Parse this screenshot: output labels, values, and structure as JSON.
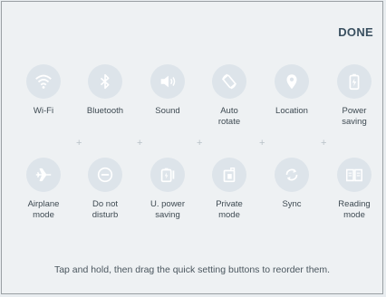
{
  "header": {
    "done_label": "DONE"
  },
  "tiles": {
    "wifi": "Wi-Fi",
    "bluetooth": "Bluetooth",
    "sound": "Sound",
    "auto_rotate": "Auto\nrotate",
    "location": "Location",
    "power_saving": "Power\nsaving",
    "airplane_mode": "Airplane\nmode",
    "do_not_disturb": "Do not\ndisturb",
    "u_power_saving": "U. power\nsaving",
    "private_mode": "Private\nmode",
    "sync": "Sync",
    "reading_mode": "Reading\nmode"
  },
  "separator_glyph": "+",
  "hint": "Tap and hold, then drag the quick setting buttons to reorder them.",
  "colors": {
    "background": "#eef1f3",
    "icon_circle": "#dde4ea",
    "icon_glyph": "#ffffff",
    "label_text": "#3e4a52",
    "done_text": "#3a5060"
  }
}
